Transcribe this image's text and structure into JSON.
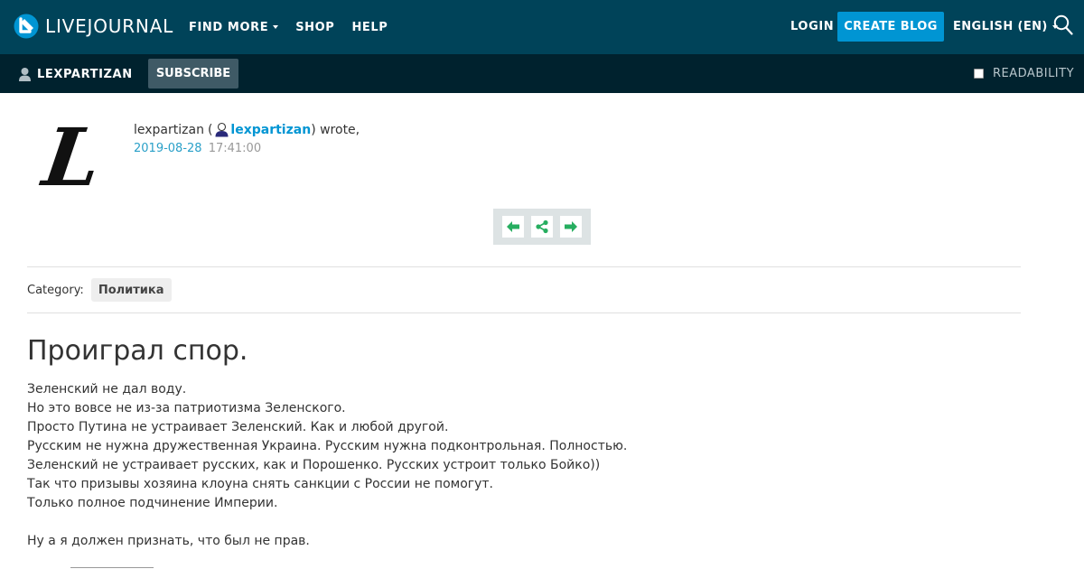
{
  "brand": {
    "name": "LIVEJOURNAL",
    "accent": "#0095d3",
    "topbar_bg": "#004359",
    "subbar_bg": "#00222e"
  },
  "topnav": {
    "find_more": "FIND MORE",
    "shop": "SHOP",
    "help": "HELP",
    "login": "LOGIN",
    "create_blog": "CREATE BLOG",
    "language": "ENGLISH (EN)",
    "search_icon": "search-icon"
  },
  "subbar": {
    "journal": "LEXPARTIZAN",
    "subscribe": "SUBSCRIBE",
    "readability": "READABILITY"
  },
  "entry": {
    "userpic_letter": "L",
    "author_plain": "lexpartizan",
    "open_paren": "(",
    "author_link": "lexpartizan",
    "wrote": ") wrote,",
    "date": "2019-08-28",
    "time": "17:41:00",
    "category_label": "Category:",
    "category_tag": "Политика",
    "title": "Проиграл спор.",
    "body": [
      "Зеленский не дал воду.",
      "Но это вовсе не из-за патриотизма Зеленского.",
      "Просто Путина не устраивает Зеленский. Как и любой другой.",
      "Русским не нужна дружественная Украина. Русским нужна подконтрольная. Полностью.",
      "Зеленский не устраивает русских, как и Порошенко. Русских устроит только Бойко))",
      "Так что призывы хозяина клоуна снять санкции с России не помогут.",
      "Только полное подчинение Империи.",
      "",
      "Ну а я должен признать, что был не прав."
    ]
  }
}
